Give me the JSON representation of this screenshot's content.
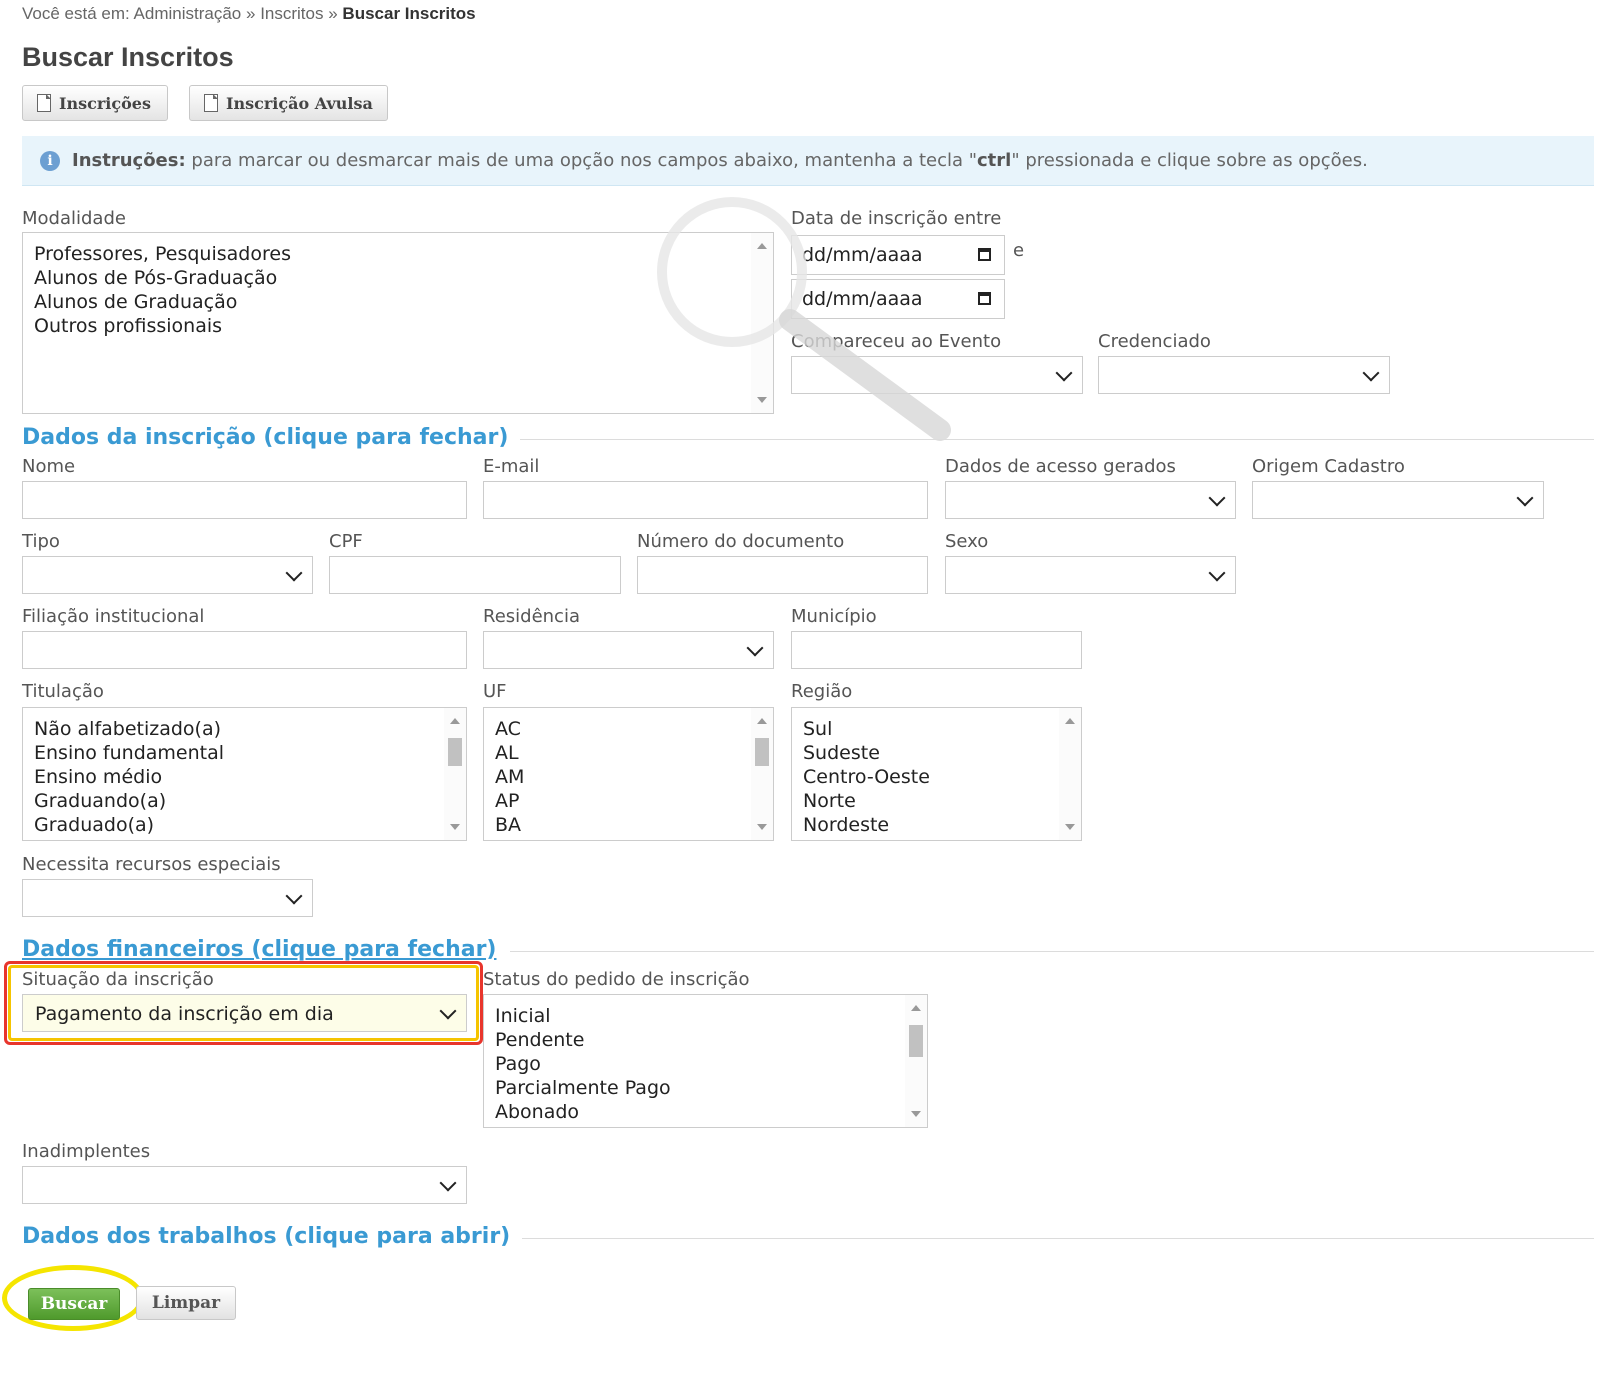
{
  "breadcrumb": {
    "prefix": "Você está em:",
    "items": [
      "Administração",
      "Inscritos"
    ],
    "separator": "»",
    "current": "Buscar Inscritos"
  },
  "page_title": "Buscar Inscritos",
  "toolbar": {
    "inscricoes_label": "Inscrições",
    "avulsa_label": "Inscrição Avulsa"
  },
  "instructions": {
    "title": "Instruções:",
    "text_before": "para marcar ou desmarcar mais de uma opção nos campos abaixo, mantenha a tecla \"",
    "key": "ctrl",
    "text_after": "\" pressionada e clique sobre as opções."
  },
  "filters": {
    "modalidade": {
      "label": "Modalidade",
      "options": [
        "Professores, Pesquisadores",
        "Alunos de Pós-Graduação",
        "Alunos de Graduação",
        "Outros profissionais"
      ]
    },
    "data_inscricao": {
      "label": "Data de inscrição entre",
      "from_placeholder": "dd/mm/aaaa",
      "to_placeholder": "dd/mm/aaaa",
      "conjunction": "e"
    },
    "compareceu": {
      "label": "Compareceu ao Evento",
      "value": ""
    },
    "credenciado": {
      "label": "Credenciado",
      "value": ""
    }
  },
  "dados_inscricao": {
    "title": "Dados da inscrição (clique para fechar)",
    "nome_label": "Nome",
    "email_label": "E-mail",
    "acesso_label": "Dados de acesso gerados",
    "origem_label": "Origem Cadastro",
    "tipo_label": "Tipo",
    "cpf_label": "CPF",
    "documento_label": "Número do documento",
    "sexo_label": "Sexo",
    "filiacao_label": "Filiação institucional",
    "residencia_label": "Residência",
    "municipio_label": "Município",
    "titulacao": {
      "label": "Titulação",
      "options": [
        "Não alfabetizado(a)",
        "Ensino fundamental",
        "Ensino médio",
        "Graduando(a)",
        "Graduado(a)"
      ]
    },
    "uf": {
      "label": "UF",
      "options": [
        "AC",
        "AL",
        "AM",
        "AP",
        "BA"
      ]
    },
    "regiao": {
      "label": "Região",
      "options": [
        "Sul",
        "Sudeste",
        "Centro-Oeste",
        "Norte",
        "Nordeste"
      ]
    },
    "recursos_label": "Necessita recursos especiais"
  },
  "dados_financeiros": {
    "title": "Dados financeiros (clique para fechar)",
    "situacao": {
      "label": "Situação da inscrição",
      "value": "Pagamento da inscrição em dia"
    },
    "status_pedido": {
      "label": "Status do pedido de inscrição",
      "options": [
        "Inicial",
        "Pendente",
        "Pago",
        "Parcialmente Pago",
        "Abonado"
      ]
    },
    "inadimplentes_label": "Inadimplentes"
  },
  "dados_trabalhos": {
    "title": "Dados dos trabalhos (clique para abrir)"
  },
  "actions": {
    "buscar_label": "Buscar",
    "limpar_label": "Limpar"
  },
  "colors": {
    "section": "#3a9ad3",
    "highlight_red": "#e8352c",
    "highlight_yellow": "#f5e500",
    "buscar_green": "#5aa634"
  }
}
